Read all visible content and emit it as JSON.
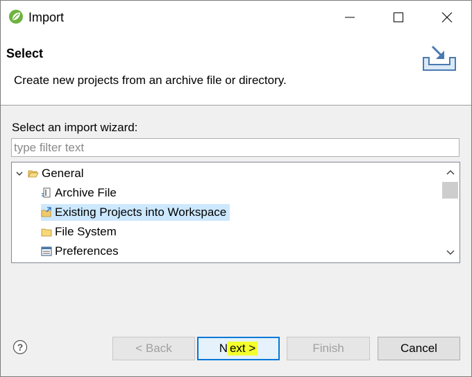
{
  "window": {
    "title": "Import",
    "icon": "spring-leaf-icon"
  },
  "banner": {
    "title": "Select",
    "description": "Create new projects from an archive file or directory.",
    "icon": "import-wizard-icon"
  },
  "wizard": {
    "prompt": "Select an import wizard:",
    "filter_placeholder": "type filter text",
    "filter_value": "",
    "tree": {
      "group_label": "General",
      "items": [
        {
          "label": "Archive File",
          "icon": "archive-file-icon"
        },
        {
          "label": "Existing Projects into Workspace",
          "icon": "existing-projects-icon",
          "selected": true
        },
        {
          "label": "File System",
          "icon": "folder-icon"
        },
        {
          "label": "Preferences",
          "icon": "preferences-icon"
        }
      ]
    }
  },
  "buttons": {
    "back": "< Back",
    "next_prefix": "N",
    "next_highlighted": "ext >",
    "finish": "Finish",
    "cancel": "Cancel"
  },
  "colors": {
    "selection": "#cce8ff",
    "highlight": "#f4ff2e",
    "default_button_border": "#0078d7"
  }
}
